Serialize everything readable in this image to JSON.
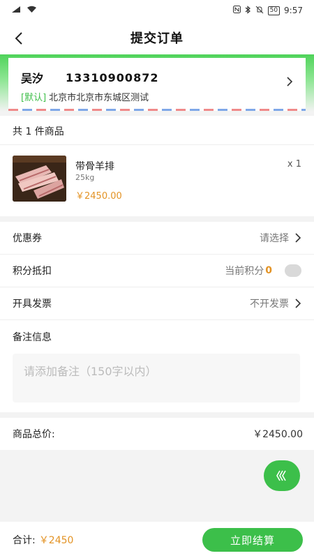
{
  "status_bar": {
    "time": "9:57",
    "battery": "50"
  },
  "header": {
    "title": "提交订单"
  },
  "address": {
    "name": "吴汐",
    "phone": "13310900872",
    "default_tag": "[默认]",
    "detail": "北京市北京市东城区测试"
  },
  "goods": {
    "count_text": "共 1 件商品",
    "items": [
      {
        "name": "带骨羊排",
        "spec": "25kg",
        "price": "￥2450.00",
        "qty": "x 1"
      }
    ]
  },
  "options": {
    "coupon": {
      "label": "优惠券",
      "value": "请选择"
    },
    "points": {
      "label": "积分抵扣",
      "value_label": "当前积分",
      "value": "0"
    },
    "invoice": {
      "label": "开具发票",
      "value": "不开发票"
    }
  },
  "remark": {
    "title": "备注信息",
    "placeholder": "请添加备注（150字以内）"
  },
  "summary": {
    "label": "商品总价:",
    "value": "￥2450.00"
  },
  "bottom_bar": {
    "total_label": "合计:",
    "total_value": "￥2450",
    "checkout_label": "立即结算"
  },
  "colors": {
    "accent": "#3cbf4a",
    "price": "#e39325"
  }
}
